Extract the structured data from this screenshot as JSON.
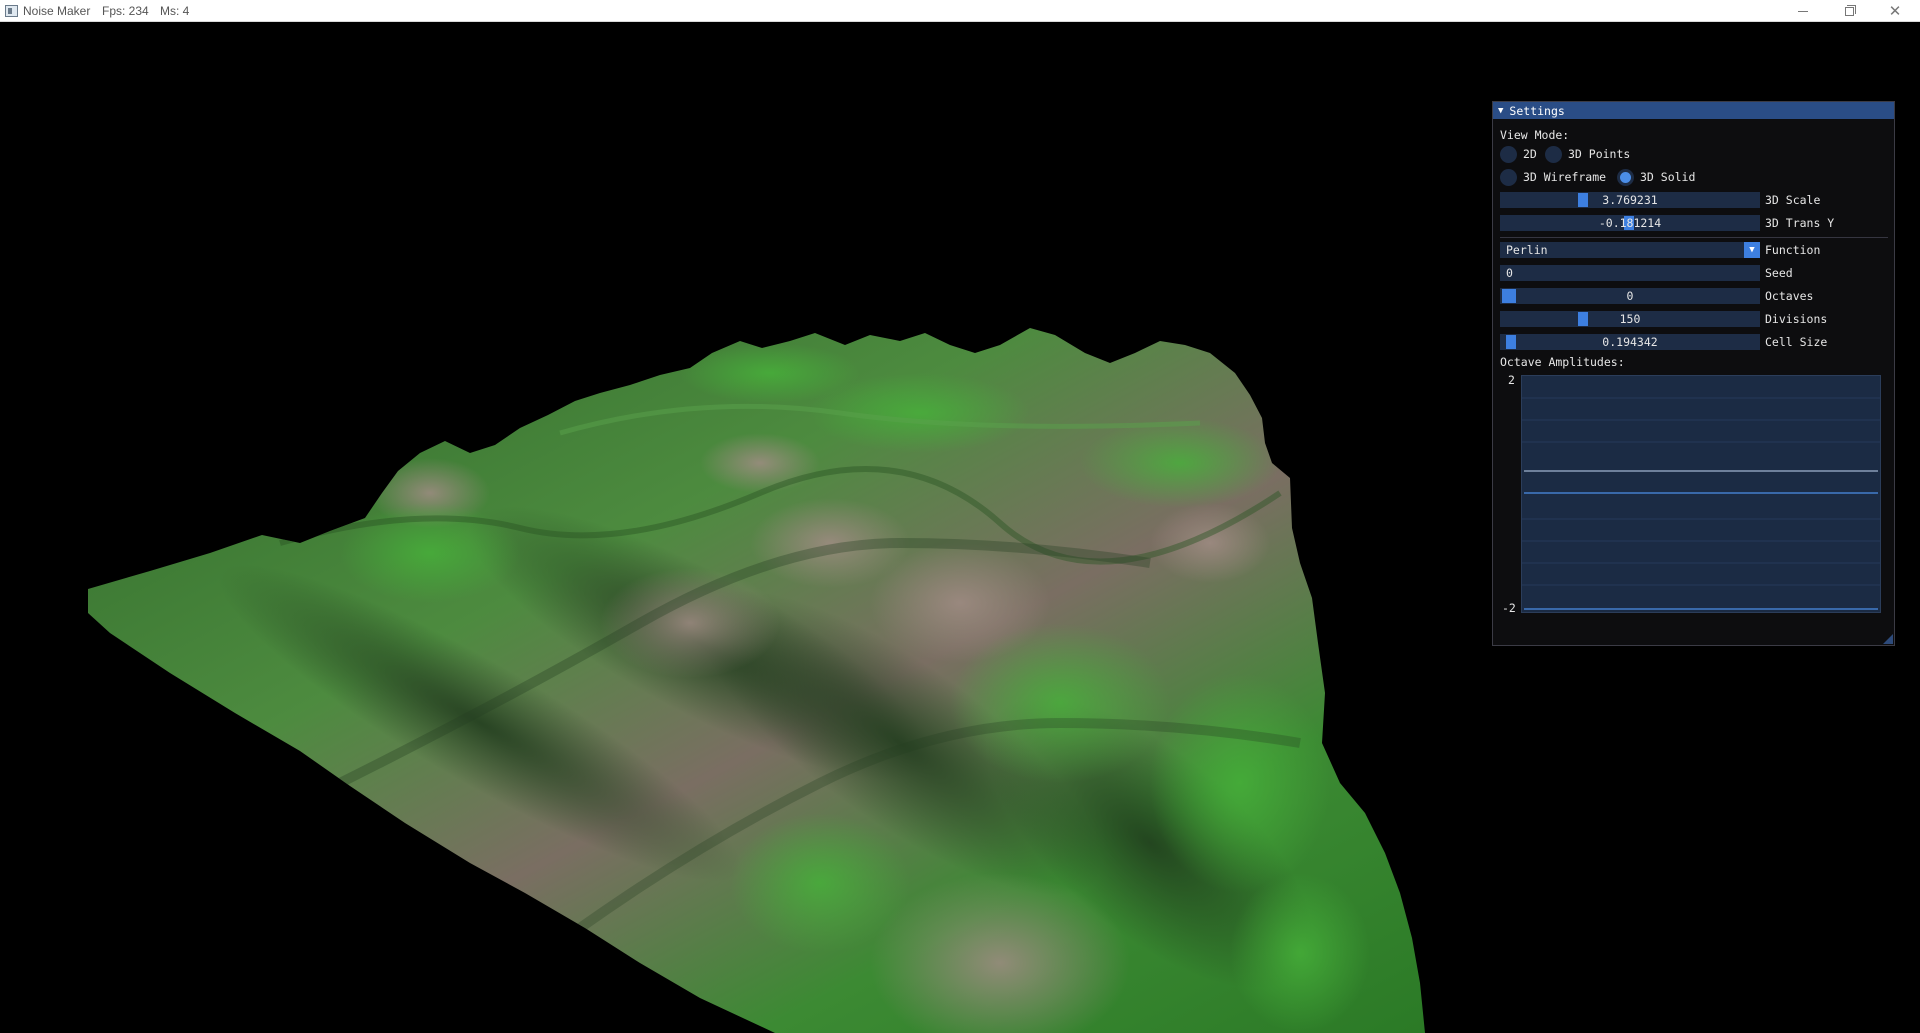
{
  "window": {
    "title": "Noise Maker",
    "fps": "Fps: 234",
    "ms": "Ms: 4",
    "minimize_icon": "minimize-icon",
    "maximize_icon": "restore-icon",
    "close_icon": "close-icon"
  },
  "colors": {
    "panel_header": "#2a4d86",
    "widget_bg": "#1d2c45",
    "accent": "#3d7fe0",
    "terrain_green": "#3f8a34",
    "terrain_rose": "#8f7f74"
  },
  "settings": {
    "title": "Settings",
    "view_mode_label": "View Mode:",
    "view_modes": [
      {
        "label": "2D",
        "selected": false
      },
      {
        "label": "3D Points",
        "selected": false
      },
      {
        "label": "3D Wireframe",
        "selected": false
      },
      {
        "label": "3D Solid",
        "selected": true
      }
    ],
    "scale": {
      "value": "3.769231",
      "label": "3D Scale"
    },
    "trans_y": {
      "value": "-0.181214",
      "label": "3D Trans Y"
    },
    "function": {
      "value": "Perlin",
      "label": "Function"
    },
    "seed": {
      "value": "0",
      "label": "Seed"
    },
    "octaves": {
      "value": "0",
      "label": "Octaves"
    },
    "divisions": {
      "value": "150",
      "label": "Divisions"
    },
    "cell_size": {
      "value": "0.194342",
      "label": "Cell Size"
    },
    "octave_amplitudes_label": "Octave Amplitudes:",
    "plot_max": "2",
    "plot_min": "-2"
  }
}
